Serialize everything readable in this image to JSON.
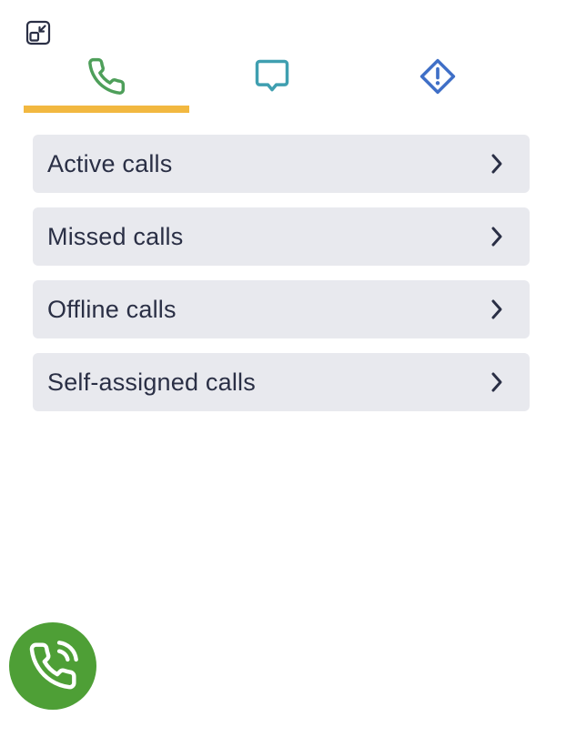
{
  "icons": {
    "minimize": "minimize-icon",
    "phone_tab": "phone-icon",
    "chat_tab": "chat-bubble-icon",
    "alert_tab": "alert-diamond-icon",
    "chevron": "chevron-right-icon",
    "call_fab": "phone-ringing-icon"
  },
  "colors": {
    "phone_tab": "#4e9f5a",
    "chat_tab": "#3f9fb0",
    "alert_tab": "#3f6fc7",
    "active_underline": "#f2b840",
    "item_background": "#e8e9ee",
    "item_text": "#2a2f45",
    "fab": "#4e9f36"
  },
  "tabs": {
    "active": "calls"
  },
  "menu": {
    "items": [
      {
        "label": "Active calls"
      },
      {
        "label": "Missed calls"
      },
      {
        "label": "Offline calls"
      },
      {
        "label": "Self-assigned calls"
      }
    ]
  }
}
